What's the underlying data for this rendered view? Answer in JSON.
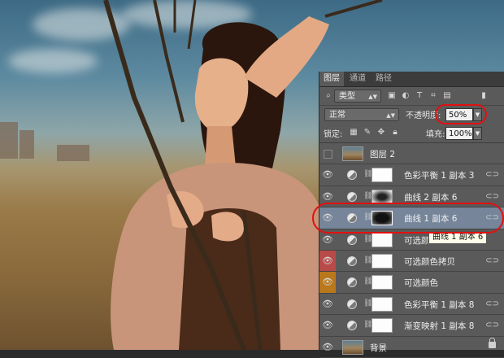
{
  "panel": {
    "tabs": [
      "图层",
      "通道",
      "路径"
    ],
    "filter_kind": "类型",
    "blend_mode": "正常",
    "opacity_label": "不透明度:",
    "opacity_value": "50%",
    "lock_label": "锁定:",
    "fill_label": "填充:",
    "fill_value": "100%",
    "highlight_color": "#e21010",
    "layers": [
      {
        "name": "图层 2",
        "visible": false,
        "kind": "image"
      },
      {
        "name": "色彩平衡 1 副本 3",
        "visible": true,
        "kind": "adjustment",
        "mask": "white",
        "linked": true
      },
      {
        "name": "曲线 2 副本 6",
        "visible": true,
        "kind": "adjustment",
        "mask": "soft",
        "linked": true
      },
      {
        "name": "曲线 1 副本 6",
        "visible": true,
        "kind": "adjustment",
        "mask": "dark",
        "linked": true,
        "selected": true
      },
      {
        "name": "可选颜色",
        "visible": true,
        "kind": "adjustment",
        "mask": "white",
        "linked": false
      },
      {
        "name": "可选颜色拷贝",
        "visible": true,
        "kind": "adjustment",
        "mask": "white",
        "linked": true,
        "eye_color": "red"
      },
      {
        "name": "可选颜色",
        "visible": true,
        "kind": "adjustment",
        "mask": "white",
        "linked": false,
        "eye_color": "orange"
      },
      {
        "name": "色彩平衡 1 副本 8",
        "visible": true,
        "kind": "adjustment",
        "mask": "white",
        "linked": true
      },
      {
        "name": "渐变映射 1 副本 8",
        "visible": true,
        "kind": "adjustment",
        "mask": "white",
        "linked": true
      },
      {
        "name": "背景",
        "visible": true,
        "kind": "image",
        "locked": true
      }
    ],
    "tooltip": "曲线 1 副本 6"
  }
}
